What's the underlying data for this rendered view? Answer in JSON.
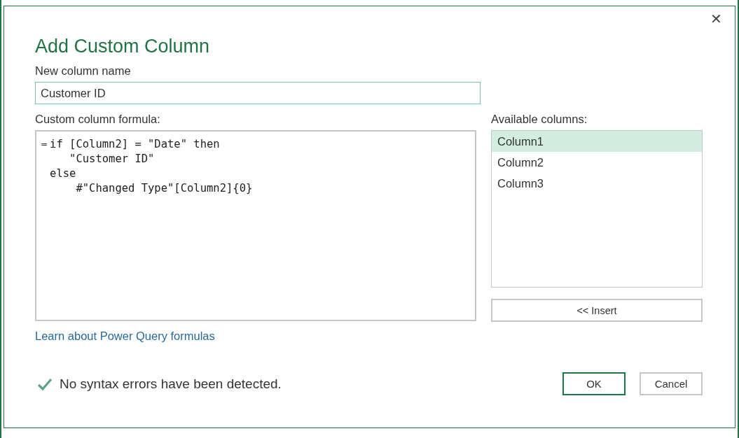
{
  "dialog": {
    "title": "Add Custom Column",
    "close": "✕"
  },
  "column_name": {
    "label": "New column name",
    "value": "Customer ID"
  },
  "formula": {
    "label": "Custom column formula:",
    "prefix": "=",
    "code": "if [Column2] = \"Date\" then\n   \"Customer ID\"\nelse\n    #\"Changed Type\"[Column2]{0}"
  },
  "available_columns": {
    "label": "Available columns:",
    "items": [
      {
        "label": "Column1",
        "selected": true
      },
      {
        "label": "Column2",
        "selected": false
      },
      {
        "label": "Column3",
        "selected": false
      }
    ]
  },
  "insert_button": "<< Insert",
  "learn_link": "Learn about Power Query formulas",
  "status": {
    "ok": true,
    "text": "No syntax errors have been detected."
  },
  "buttons": {
    "ok": "OK",
    "cancel": "Cancel"
  }
}
